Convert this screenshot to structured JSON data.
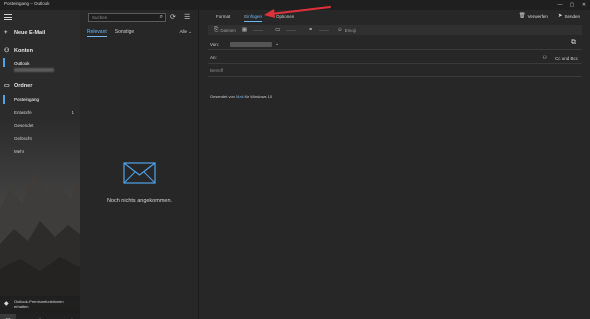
{
  "window": {
    "title": "Posteingang – Outlook",
    "controls": [
      "—",
      "▢",
      "✕"
    ]
  },
  "nav": {
    "new_mail": "Neue E-Mail",
    "accounts_header": "Konten",
    "account_name": "Outlook",
    "folders_header": "Ordner",
    "folders": [
      {
        "label": "Posteingang",
        "selected": true,
        "count": ""
      },
      {
        "label": "Entwürfe",
        "selected": false,
        "count": "1"
      },
      {
        "label": "Gesendet",
        "selected": false,
        "count": ""
      },
      {
        "label": "Gelöscht",
        "selected": false,
        "count": ""
      },
      {
        "label": "Mehr",
        "selected": false,
        "count": ""
      }
    ],
    "promo": "Outlook-Premiumfunktionen erhalten",
    "bottom_icons": [
      "mail-icon",
      "calendar-icon",
      "people-icon",
      "todo-icon",
      "settings-icon"
    ]
  },
  "list": {
    "search_placeholder": "Suchen",
    "tabs": [
      "Relevant",
      "Sonstige"
    ],
    "active_tab": "Relevant",
    "filter_label": "Alle",
    "empty_message": "Noch nichts angekommen."
  },
  "compose": {
    "ribbon_tabs": [
      "Format",
      "Einfügen",
      "Optionen"
    ],
    "active_ribbon_tab": "Einfügen",
    "toolbar": {
      "discard": "Verwerfen",
      "send": "Senden"
    },
    "ribbon_items": [
      "Dateien",
      "Emoji"
    ],
    "from_label": "Von:",
    "to_label": "An:",
    "cc_label": "Cc und Bcc",
    "subject_placeholder": "Betreff",
    "signature_prefix": "Gesendet von",
    "signature_link": "Mail",
    "signature_suffix": "für Windows 10"
  },
  "colors": {
    "accent": "#6db6f2",
    "annotation_arrow": "#e0303a"
  }
}
